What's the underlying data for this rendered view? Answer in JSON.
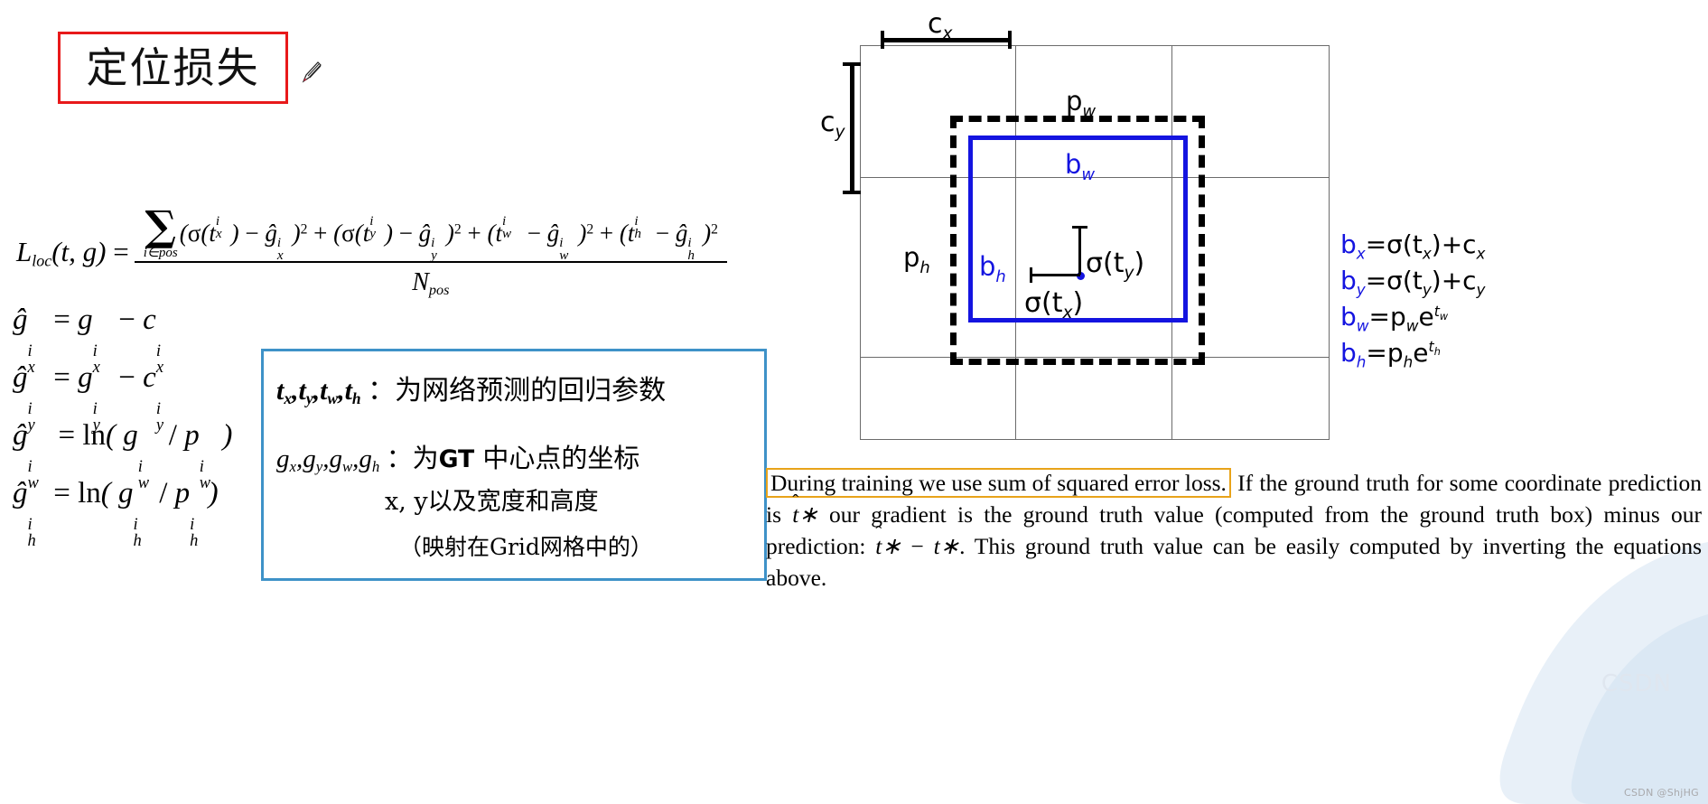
{
  "slide": {
    "title": "定位损失",
    "title_border_color": "#e8191a",
    "pen_cursor": "pen-icon"
  },
  "loss_formula": {
    "lhs": "L",
    "lhs_sub": "loc",
    "lhs_args": "(t, g) =",
    "sum_symbol": "∑",
    "sum_limit": "i∈pos",
    "numerator": "(σ(txi) − ĝxi)2 + (σ(tyi) − ĝyi)2 + (twi − ĝwi)2 + (thi − ĝhi)2",
    "denominator": "N",
    "denominator_sub": "pos",
    "terms": [
      {
        "left_fn": "σ(",
        "left_var": "t",
        "left_sub": "x",
        "right_var": "g",
        "right_sub": "x"
      },
      {
        "left_fn": "σ(",
        "left_var": "t",
        "left_sub": "y",
        "right_var": "g",
        "right_sub": "y"
      },
      {
        "left_fn": "",
        "left_var": "t",
        "left_sub": "w",
        "right_var": "g",
        "right_sub": "w"
      },
      {
        "left_fn": "",
        "left_var": "t",
        "left_sub": "h",
        "right_var": "g",
        "right_sub": "h"
      }
    ]
  },
  "ghat_equations": [
    {
      "lhs_sub": "x",
      "rhs": "g_x - c_x",
      "kind": "sub"
    },
    {
      "lhs_sub": "y",
      "rhs": "g_y - c_y",
      "kind": "sub"
    },
    {
      "lhs_sub": "w",
      "rhs": "ln( g_w / p_w )",
      "kind": "ln"
    },
    {
      "lhs_sub": "h",
      "rhs": "ln( g_h / p_h )",
      "kind": "ln"
    }
  ],
  "info_box": {
    "border_color": "#3e92c8",
    "line1_vars": "t",
    "line1_text": "：为网络预测的回归参数",
    "line2_vars": "g",
    "line2_text_a": "：为",
    "line2_text_gt": "GT",
    "line2_text_b": " 中心点的坐标",
    "line3": "x, y以及宽度和高度",
    "line4": "（映射在Grid网格中的）"
  },
  "diagram": {
    "labels": {
      "cx": "c",
      "cx_sub": "x",
      "cy": "c",
      "cy_sub": "y",
      "pw": "p",
      "pw_sub": "w",
      "ph": "p",
      "ph_sub": "h",
      "bw": "b",
      "bw_sub": "w",
      "bh": "b",
      "bh_sub": "h",
      "sigma_tx": "σ(t",
      "sigma_tx_sub": "x",
      "sigma_ty": "σ(t",
      "sigma_ty_sub": "y"
    },
    "colors": {
      "grid": "#6b6b6b",
      "prior_box": "#000000",
      "pred_box": "#1414e0"
    }
  },
  "box_equations": [
    {
      "lhs": "b",
      "lhs_sub": "x",
      "rhs": "=σ(t",
      "rhs_sub": "x",
      "tail": ")+c",
      "tail_sub": "x"
    },
    {
      "lhs": "b",
      "lhs_sub": "y",
      "rhs": "=σ(t",
      "rhs_sub": "y",
      "tail": ")+c",
      "tail_sub": "y"
    },
    {
      "lhs": "b",
      "lhs_sub": "w",
      "rhs": "=p",
      "rhs_sub": "w",
      "tail": "e",
      "tail_sup": "t",
      "tail_sup_sub": "w"
    },
    {
      "lhs": "b",
      "lhs_sub": "h",
      "rhs": "=p",
      "rhs_sub": "h",
      "tail": "e",
      "tail_sup": "t",
      "tail_sup_sub": "h"
    }
  ],
  "paper": {
    "highlight": "During training we use sum of squared error loss.",
    "highlight_border_color": "#e8a31a",
    "rest_1": " If the ground truth for some coordinate prediction is ",
    "gt_symbol": "t",
    "gt_sub": "*",
    "rest_2": " our gradient is the ground truth value (computed from the ground truth box) minus our prediction: ",
    "diff_a": "t",
    "diff_a_sub": "*",
    "diff_minus": " − ",
    "diff_b": "t",
    "diff_b_sub": "*",
    "rest_3": ". This ground truth value can be easily computed by inverting the equations above."
  },
  "watermark": {
    "big": "CSDN",
    "credit": "CSDN @ShjHG"
  }
}
